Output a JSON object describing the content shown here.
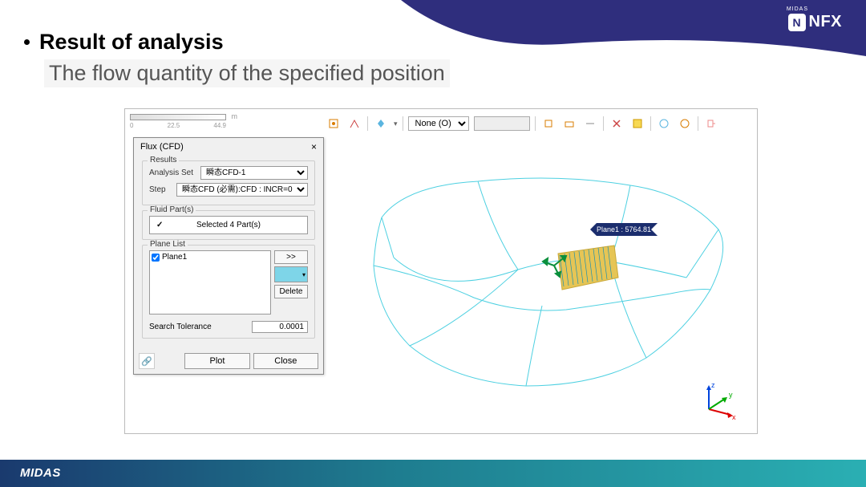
{
  "brand": {
    "nfx": "NFX",
    "midas_small": "MIDAS",
    "n_icon": "N",
    "midas_footer": "MIDAS"
  },
  "title": "Result of analysis",
  "subtitle": "The flow quantity of the specified position",
  "ruler": {
    "tick0": "0",
    "tick1": "22.5",
    "tick2": "44.9",
    "unit": "m"
  },
  "toolbar": {
    "none_option": "None (O)",
    "dropdown_empty": ""
  },
  "dialog": {
    "title": "Flux (CFD)",
    "close": "×",
    "results_label": "Results",
    "analysis_set_label": "Analysis Set",
    "analysis_set_value": "瞬态CFD-1",
    "step_label": "Step",
    "step_value": "瞬态CFD (必需):CFD : INCR=0",
    "fluid_parts_label": "Fluid Part(s)",
    "selected_parts": "Selected 4 Part(s)",
    "check": "✓",
    "plane_list_label": "Plane List",
    "plane1": "Plane1",
    "move_btn": ">>",
    "delete_btn": "Delete",
    "tolerance_label": "Search Tolerance",
    "tolerance_value": "0.0001",
    "plot_btn": "Plot",
    "close_btn": "Close",
    "link_icon": "🔗"
  },
  "annotation": "Plane1 : 5764.81",
  "axes": {
    "x": "x",
    "y": "y",
    "z": "z"
  }
}
